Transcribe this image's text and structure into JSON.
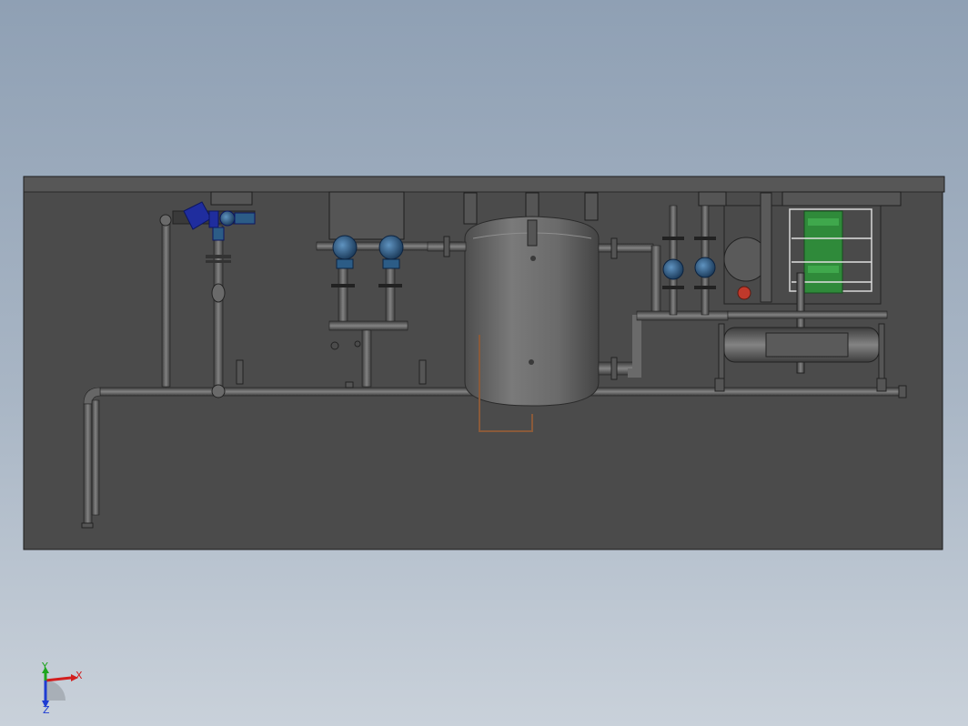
{
  "viewport": {
    "colors": {
      "background_top": "#8fa0b4",
      "background_bottom": "#c9d1da",
      "frame_fill": "#4c4c4c",
      "frame_edge": "#1e1e1e",
      "pipe": "#5e5e5e",
      "pipe_highlight": "#8a8a8a",
      "tank": "#6a6a6a",
      "pump_blue": "#2c5c86",
      "valve_blue": "#1f2d9e",
      "heat_exchanger_green": "#2f8a3a",
      "copper_line": "#8a5a3a",
      "red_valve": "#c0392b"
    }
  },
  "triad": {
    "x_label": "X",
    "y_label": "Y",
    "z_label": "Z",
    "x_color": "#d21e1e",
    "y_color": "#1ea51e",
    "z_color": "#1e3cd2"
  }
}
